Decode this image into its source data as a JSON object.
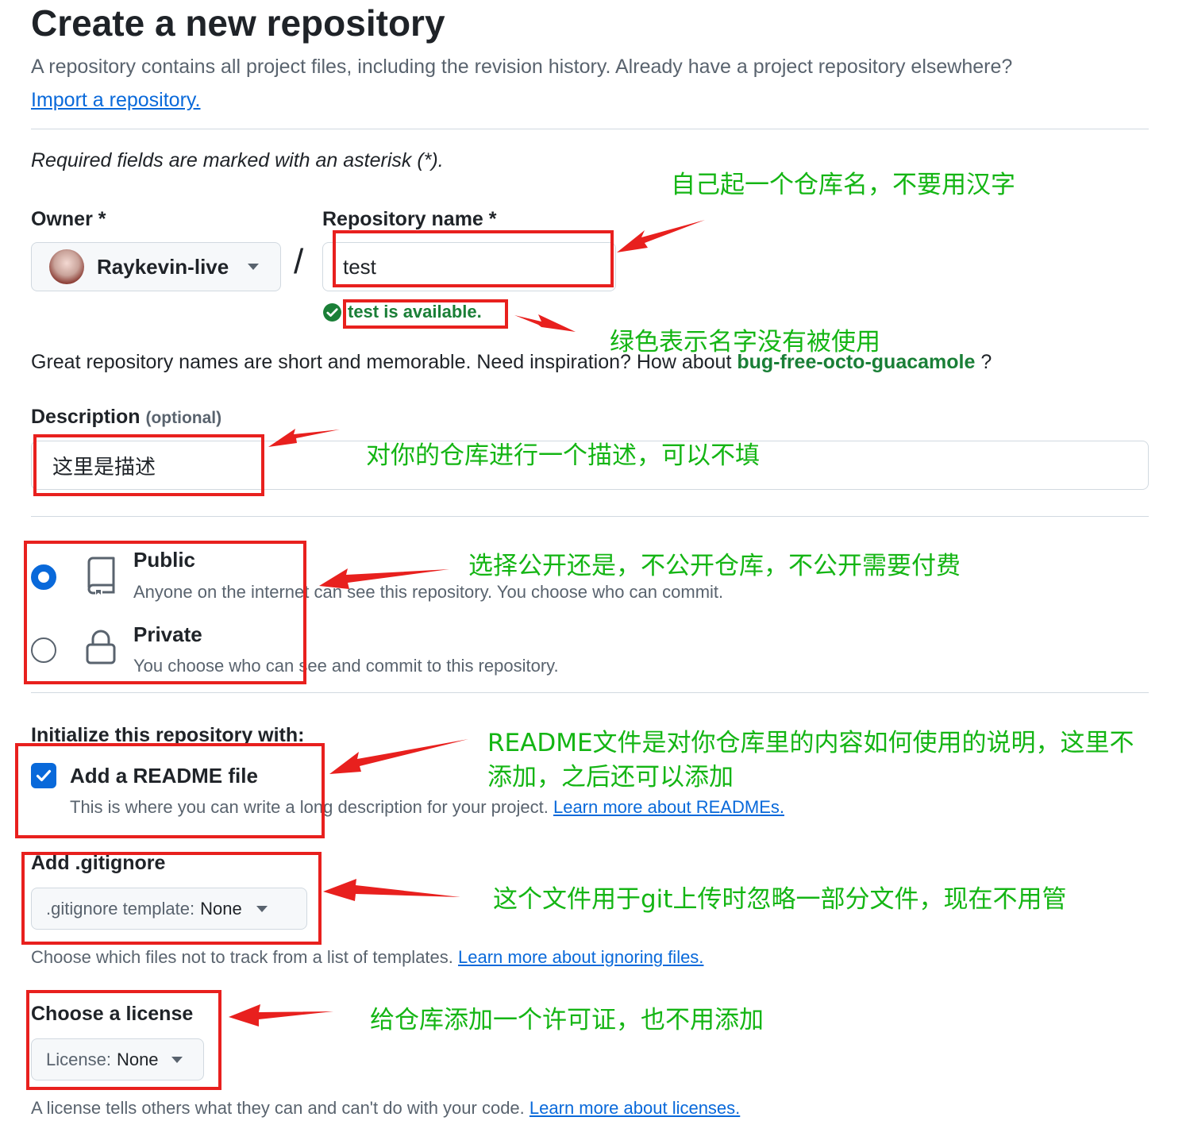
{
  "header": {
    "title": "Create a new repository",
    "subtitle": "A repository contains all project files, including the revision history. Already have a project repository elsewhere?",
    "import_link": "Import a repository."
  },
  "required_note": "Required fields are marked with an asterisk (*).",
  "owner": {
    "label": "Owner *",
    "value": "Raykevin-live"
  },
  "separator": "/",
  "repo_name": {
    "label": "Repository name *",
    "value": "test",
    "availability": "test is available."
  },
  "inspiration": {
    "text": "Great repository names are short and memorable. Need inspiration? How about",
    "suggestion": "bug-free-octo-guacamole",
    "suffix": "?"
  },
  "description": {
    "label": "Description",
    "optional": "(optional)",
    "value": "这里是描述"
  },
  "visibility": {
    "public": {
      "title": "Public",
      "desc": "Anyone on the internet can see this repository. You choose who can commit.",
      "selected": true
    },
    "private": {
      "title": "Private",
      "desc": "You choose who can see and commit to this repository.",
      "selected": false
    }
  },
  "initialize": {
    "heading": "Initialize this repository with:",
    "readme_title": "Add a README file",
    "readme_checked": true,
    "readme_desc": "This is where you can write a long description for your project.",
    "readme_link": "Learn more about READMEs."
  },
  "gitignore": {
    "heading": "Add .gitignore",
    "button_prefix": ".gitignore template:",
    "button_value": "None",
    "help": "Choose which files not to track from a list of templates.",
    "help_link": "Learn more about ignoring files."
  },
  "license": {
    "heading": "Choose a license",
    "button_prefix": "License:",
    "button_value": "None",
    "help": "A license tells others what they can and can't do with your code.",
    "help_link": "Learn more about licenses."
  },
  "annotations": {
    "repo_name": "自己起一个仓库名，不要用汉字",
    "available": "绿色表示名字没有被使用",
    "description": "对你的仓库进行一个描述，可以不填",
    "visibility": "选择公开还是，不公开仓库，不公开需要付费",
    "readme_line1": "README文件是对你仓库里的内容如何使用的说明，这里不",
    "readme_line2": "添加，之后还可以添加",
    "gitignore": "这个文件用于git上传时忽略一部分文件，现在不用管",
    "license": "给仓库添加一个许可证，也不用添加"
  },
  "colors": {
    "accent_blue": "#0969da",
    "success_green": "#1a7f37",
    "annotation_red": "#e8201e",
    "annotation_green": "#14b514"
  }
}
